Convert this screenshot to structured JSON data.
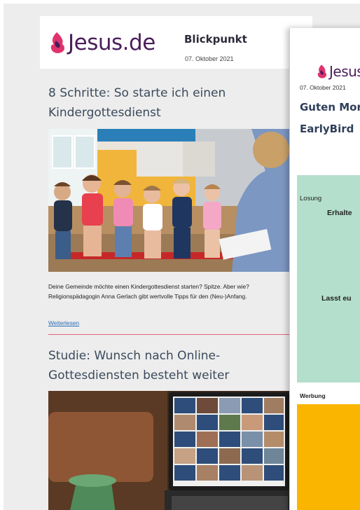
{
  "newsletter_back": {
    "logo_text": "Jesus.de",
    "title": "Blickpunkt",
    "date": "07. Oktober 2021",
    "articles": [
      {
        "title": "8 Schritte: So starte ich einen Kindergottesdienst",
        "teaser": "Deine Gemeinde möchte einen Kindergottesdienst starten? Spitze. Aber wie? Religionspädagogin Anna Gerlach gibt wertvolle Tipps für den (Neu-)Anfang.",
        "link_label": "Weiterlesen"
      },
      {
        "title": "Studie: Wunsch nach Online-Gottesdiensten besteht weiter"
      }
    ]
  },
  "newsletter_front": {
    "logo_text": "Jesus.de",
    "date": "07. Oktober 2021",
    "title_line1": "Guten Morgen",
    "title_line2": "EarlyBird",
    "losung_label": "Losung",
    "losung_line1": "Erhalte",
    "losung_line2": "Lasst eu",
    "ad_label": "Werbung"
  },
  "colors": {
    "brand_purple": "#4a1e5c",
    "brand_pink": "#e0336e",
    "losung_bg": "#b4dfcd",
    "ad_bg": "#f9b500",
    "link": "#2a6cb5"
  }
}
